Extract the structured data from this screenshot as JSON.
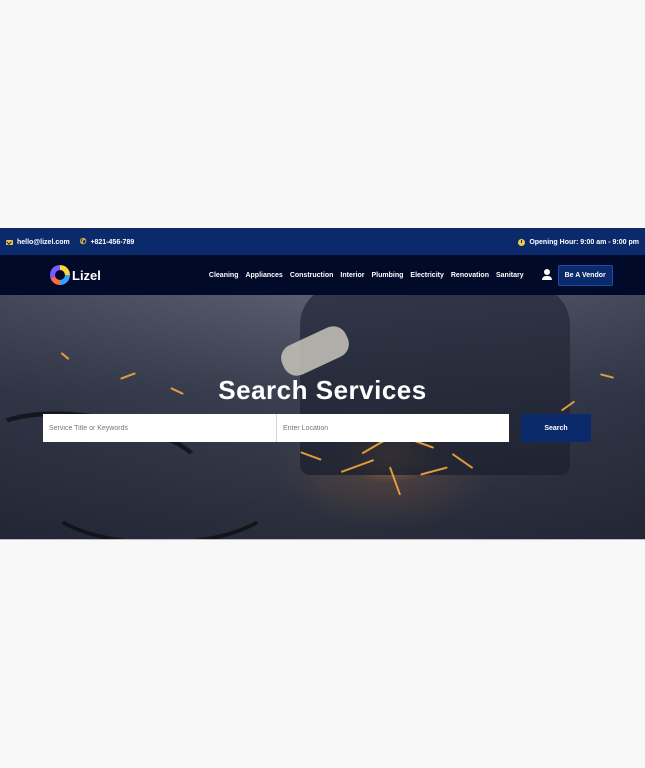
{
  "topbar": {
    "email": "hello@lizel.com",
    "phone": "+821-456-789",
    "hours": "Opening Hour: 9:00 am - 9:00 pm",
    "icons": [
      "mail-icon",
      "phone-icon",
      "clock-icon"
    ]
  },
  "nav": {
    "logo_text": "Lizel",
    "menu": [
      "Cleaning",
      "Appliances",
      "Construction",
      "Interior",
      "Plumbing",
      "Electricity",
      "Renovation",
      "Sanitary"
    ],
    "vendor_button": "Be A Vendor"
  },
  "hero": {
    "title": "Search Services",
    "keyword_placeholder": "Service Title or Keywords",
    "location_placeholder": "Enter Location",
    "search_button": "Search"
  },
  "colors": {
    "topbar_bg": "#0b2a6b",
    "nav_bg": "#020a2a",
    "accent": "#f2c94c",
    "button_bg": "#0b2a6b"
  }
}
